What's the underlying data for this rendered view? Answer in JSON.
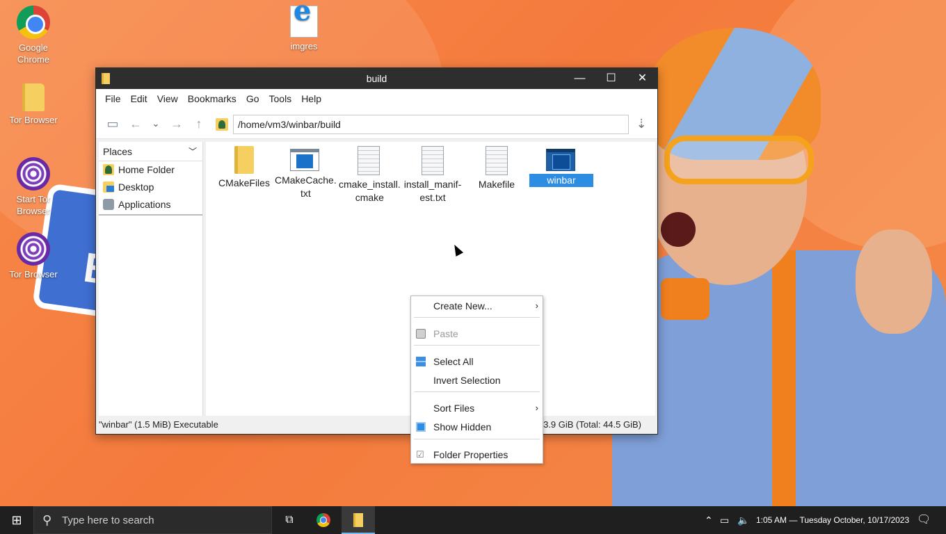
{
  "desktop": {
    "icons": [
      {
        "label": "Google Chrome"
      },
      {
        "label": "imgres"
      },
      {
        "label": "Tor Browser"
      },
      {
        "label": "Start Tor Browser"
      },
      {
        "label": "Tor Browser"
      }
    ],
    "background_text": "B"
  },
  "window": {
    "title": "build",
    "controls": {
      "minimize": "—",
      "maximize": "☐",
      "close": "✕"
    },
    "menu": [
      "File",
      "Edit",
      "View",
      "Bookmarks",
      "Go",
      "Tools",
      "Help"
    ],
    "address": "/home/vm3/winbar/build",
    "sidebar": {
      "header": "Places",
      "items": [
        "Home Folder",
        "Desktop",
        "Applications"
      ]
    },
    "files": [
      {
        "name": "CMakeFiles",
        "type": "folder"
      },
      {
        "name": "CMakeCache.\ntxt",
        "type": "app"
      },
      {
        "name": "cmake_install.\ncmake",
        "type": "doc"
      },
      {
        "name": "install_manif-\nest.txt",
        "type": "doc"
      },
      {
        "name": "Makefile",
        "type": "doc"
      },
      {
        "name": "winbar",
        "type": "app",
        "selected": true
      }
    ],
    "status_left": "\"winbar\" (1.5 MiB) Executable",
    "status_right": "3.9 GiB (Total: 44.5 GiB)"
  },
  "context_menu": {
    "items": [
      {
        "label": "Create New...",
        "submenu": true
      },
      {
        "label": "Paste",
        "disabled": true
      },
      {
        "label": "Select All"
      },
      {
        "label": "Invert Selection"
      },
      {
        "label": "Sort Files",
        "submenu": true
      },
      {
        "label": "Show Hidden"
      },
      {
        "label": "Folder Properties"
      }
    ]
  },
  "taskbar": {
    "search_placeholder": "Type here to search",
    "clock": "1:05 AM — Tuesday October, 10/17/2023"
  },
  "colors": {
    "accent": "#2d8de3",
    "desktop_bg": "#f47a3c",
    "taskbar": "#1f1f1f",
    "titlebar": "#2e2e2e"
  }
}
